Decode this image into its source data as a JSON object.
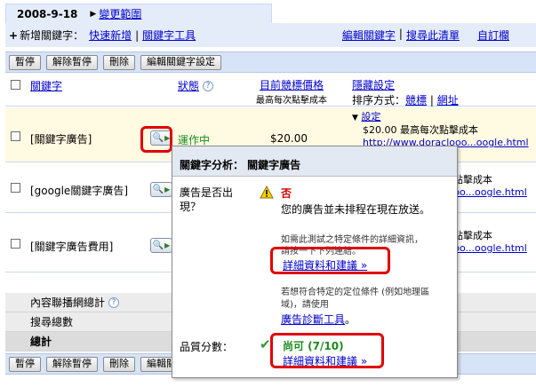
{
  "date_bar": {
    "date": "2008-9-18",
    "change_range": "變更範圍"
  },
  "links": {
    "new_keyword_label": "新增關鍵字：",
    "quick_add": "快速新增",
    "keyword_tool": "關鍵字工具",
    "edit_keywords": "編輯關鍵字",
    "search_list": "搜尋此清單",
    "customize": "自訂欄"
  },
  "toolbar": {
    "pause": "暫停",
    "resume": "解除暫停",
    "delete": "刪除",
    "edit_settings": "編輯關鍵字設定"
  },
  "table": {
    "headers": {
      "keyword": "關鍵字",
      "status": "狀態",
      "bid": "目前競標價格",
      "bid_sub": "最高每次點擊成本",
      "hidden_settings": "隱藏設定",
      "sort_label": "排序方式：",
      "sort_bid": "競標",
      "sort_url": "網址"
    },
    "rows": [
      {
        "keyword": "[關鍵字廣告]",
        "status": "運作中",
        "bid": "$20.00",
        "setting_label": "設定",
        "setting_text": "$20.00 最高每次點擊成本",
        "url": "http://www.doraclooo...oogle.html"
      },
      {
        "keyword": "[google關鍵字廣告]",
        "setting_text": "點擊成本",
        "url": "bo...oogle.html"
      },
      {
        "keyword": "[關鍵字廣告費用]",
        "setting_text": "點擊成本",
        "url": "bo...oogle.html"
      }
    ],
    "totals": {
      "content_network": "內容聯播網總計",
      "search_total": "搜尋總數",
      "total": "總計"
    }
  },
  "popup": {
    "title": "關鍵字分析： 關鍵字廣告",
    "showing_label": "廣告是否出現？",
    "no": "否",
    "not_showing": "您的廣告並未排程在現在放送。",
    "test_hint": "如需此測試之特定條件的詳細資訊，",
    "test_hint2": "請按一下下列連結。",
    "details_link": "詳細資料和建議 »",
    "location_hint": "若想符合特定的定位條件 (例如地理區域)，請使用",
    "diagnostic_link": "廣告診斷工具",
    "diagnostic_period": "。",
    "quality_label": "品質分數：",
    "quality_value": "尚可 (7/10)",
    "quality_link": "詳細資料和建議 »"
  }
}
